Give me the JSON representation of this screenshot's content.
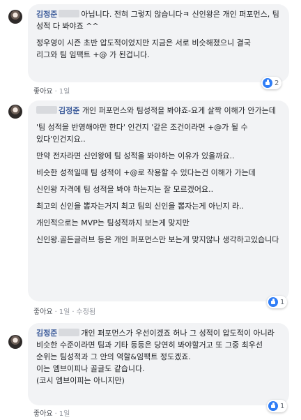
{
  "comments": [
    {
      "author": "김정준",
      "text_first": "아닙니다. 전혀 그렇지 않습니다ㅋ 신인왕은 개인 퍼포먼스, 팀 성적 다 봐야죠 ^^",
      "paragraphs": [
        "정우영이 시즌 초반 압도적이었지만 지금은 서로 비슷해졌으니 결국\n리그와 팀 임팩트 +@ 가 된겁니다."
      ],
      "like_label": "좋아요",
      "time": "1일",
      "edited": "",
      "reaction_count": "2"
    },
    {
      "author": "김정준",
      "text_first": "개인 퍼포먼스와 팀성적을 봐야죠-요게 살짝 이해가 안가는데",
      "paragraphs": [
        "'팀 성적을 반영해야만 한다' 인건지 '같은 조건이라면 +@가 될 수 있다'인건지요..",
        "만약 전자라면 신인왕에 팀 성적을 봐야하는 이유가 있을까요..",
        "비슷한 성적일때 팀 성적이 +@로 작용할 수 있다는건 이해가 가는데",
        "신인왕 자격에 팀 성적을 봐야 하는지는 잘 모르겠어요..",
        "최고의 신인을 뽑자는거지 최고 팀의 신인을 뽑자는게 아닌지 라..",
        "개인적으로는 MVP는 팀성적까지 보는게 맞지만",
        "신인왕.골든글러브 등은 개인 퍼포먼스만 보는게 맞지않나 생각하고있습니다"
      ],
      "like_label": "좋아요",
      "time": "1일",
      "edited": "수정됨",
      "reaction_count": "1"
    },
    {
      "author": "김정준",
      "text_first": "개인 퍼포먼스가 우선이겠죠 허나 그 성적이 압도적이 아니라 비슷한 수준이라면 팀과 기타 등등은 당연히 봐야할거고 또 그중 최우선 순위는 팀성적과 그 안의 역할&임팩트 정도겠죠.\n이는 엠브이피나 골글도 같습니다.\n(코시 엠브이피는 아니지만)",
      "paragraphs": [],
      "like_label": "좋아요",
      "time": "1일",
      "edited": "",
      "reaction_count": "1"
    }
  ]
}
